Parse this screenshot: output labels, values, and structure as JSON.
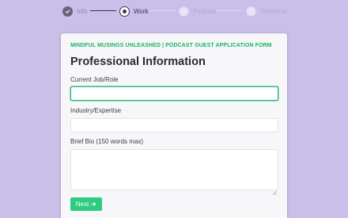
{
  "stepper": {
    "steps": [
      {
        "label": "Info",
        "state": "done"
      },
      {
        "label": "Work",
        "state": "current"
      },
      {
        "label": "Podcast",
        "state": "upcoming"
      },
      {
        "label": "Technical",
        "state": "upcoming"
      }
    ]
  },
  "form": {
    "eyebrow": "MINDFUL MUSINGS UNLEASHED | PODCAST GUEST APPLICATION FORM",
    "title": "Professional Information",
    "fields": {
      "job": {
        "label": "Current Job/Role",
        "value": "",
        "placeholder": ""
      },
      "industry": {
        "label": "Industry/Expertise",
        "value": "",
        "placeholder": ""
      },
      "bio": {
        "label": "Brief Bio (150 words max)",
        "value": "",
        "placeholder": ""
      }
    },
    "next_label": "Next",
    "next_icon": "arrow-right-icon"
  },
  "colors": {
    "background": "#c9bfe8",
    "accent": "#2ecc80",
    "eyebrow": "#19b465",
    "step_active": "#3a3550"
  }
}
